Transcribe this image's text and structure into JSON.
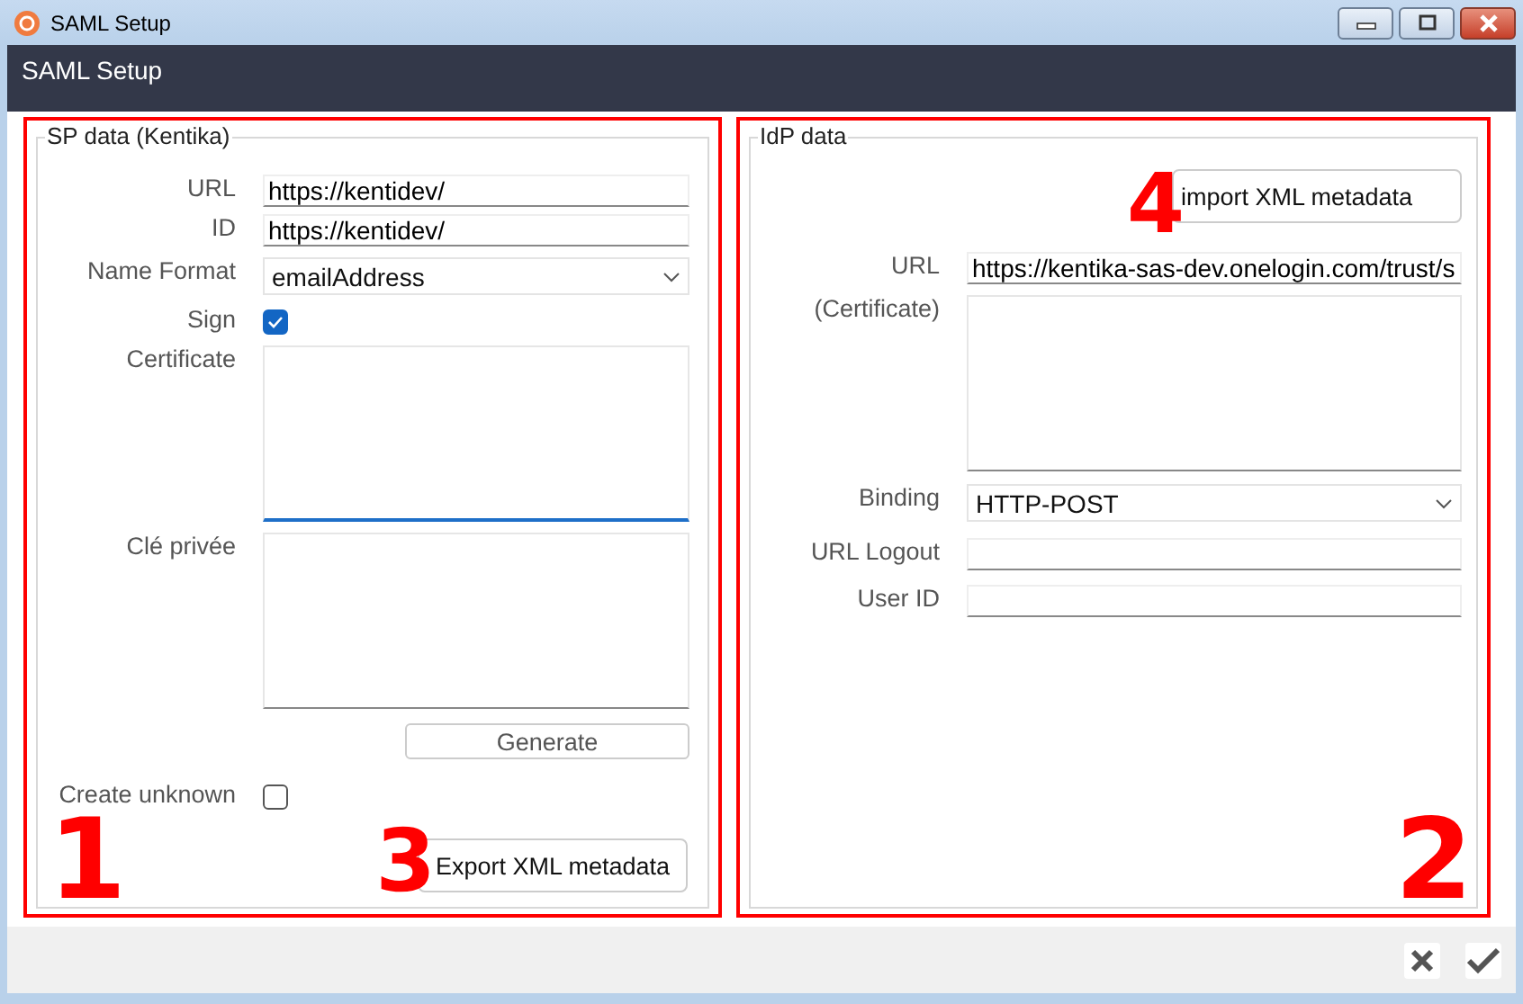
{
  "window": {
    "title": "SAML Setup"
  },
  "header": {
    "title": "SAML Setup"
  },
  "sp_panel": {
    "legend": "SP data (Kentika)",
    "callout": "1",
    "fields": [
      {
        "kind": "text",
        "label": "URL",
        "value": "https://kentidev/",
        "focused": false
      },
      {
        "kind": "text",
        "label": "ID",
        "value": "https://kentidev/",
        "focused": false
      },
      {
        "kind": "select",
        "label": "Name Format",
        "value": "emailAddress",
        "focused": false
      },
      {
        "kind": "checkbox",
        "label": "Sign",
        "checked": true
      },
      {
        "kind": "textarea",
        "label": "Certificate",
        "focused": true
      },
      {
        "kind": "textarea",
        "label": "Clé privée",
        "focused": false
      },
      {
        "kind": "button",
        "label": "Generate"
      },
      {
        "kind": "checkbox",
        "label": "Create unknown",
        "checked": false
      }
    ],
    "action": {
      "label": "Export XML metadata",
      "callout": "3"
    }
  },
  "idp_panel": {
    "legend": "IdP data",
    "callout": "2",
    "action": {
      "label": "import XML metadata",
      "callout": "4"
    },
    "fields": [
      {
        "kind": "text",
        "label": "URL",
        "value": "https://kentika-sas-dev.onelogin.com/trust/s",
        "focused": false
      },
      {
        "kind": "textarea",
        "label": "(Certificate)",
        "focused": false
      },
      {
        "kind": "select",
        "label": "Binding",
        "value": "HTTP-POST",
        "focused": false
      },
      {
        "kind": "text",
        "label": "URL Logout",
        "focused": false
      },
      {
        "kind": "text",
        "label": "User ID",
        "focused": false
      }
    ]
  }
}
